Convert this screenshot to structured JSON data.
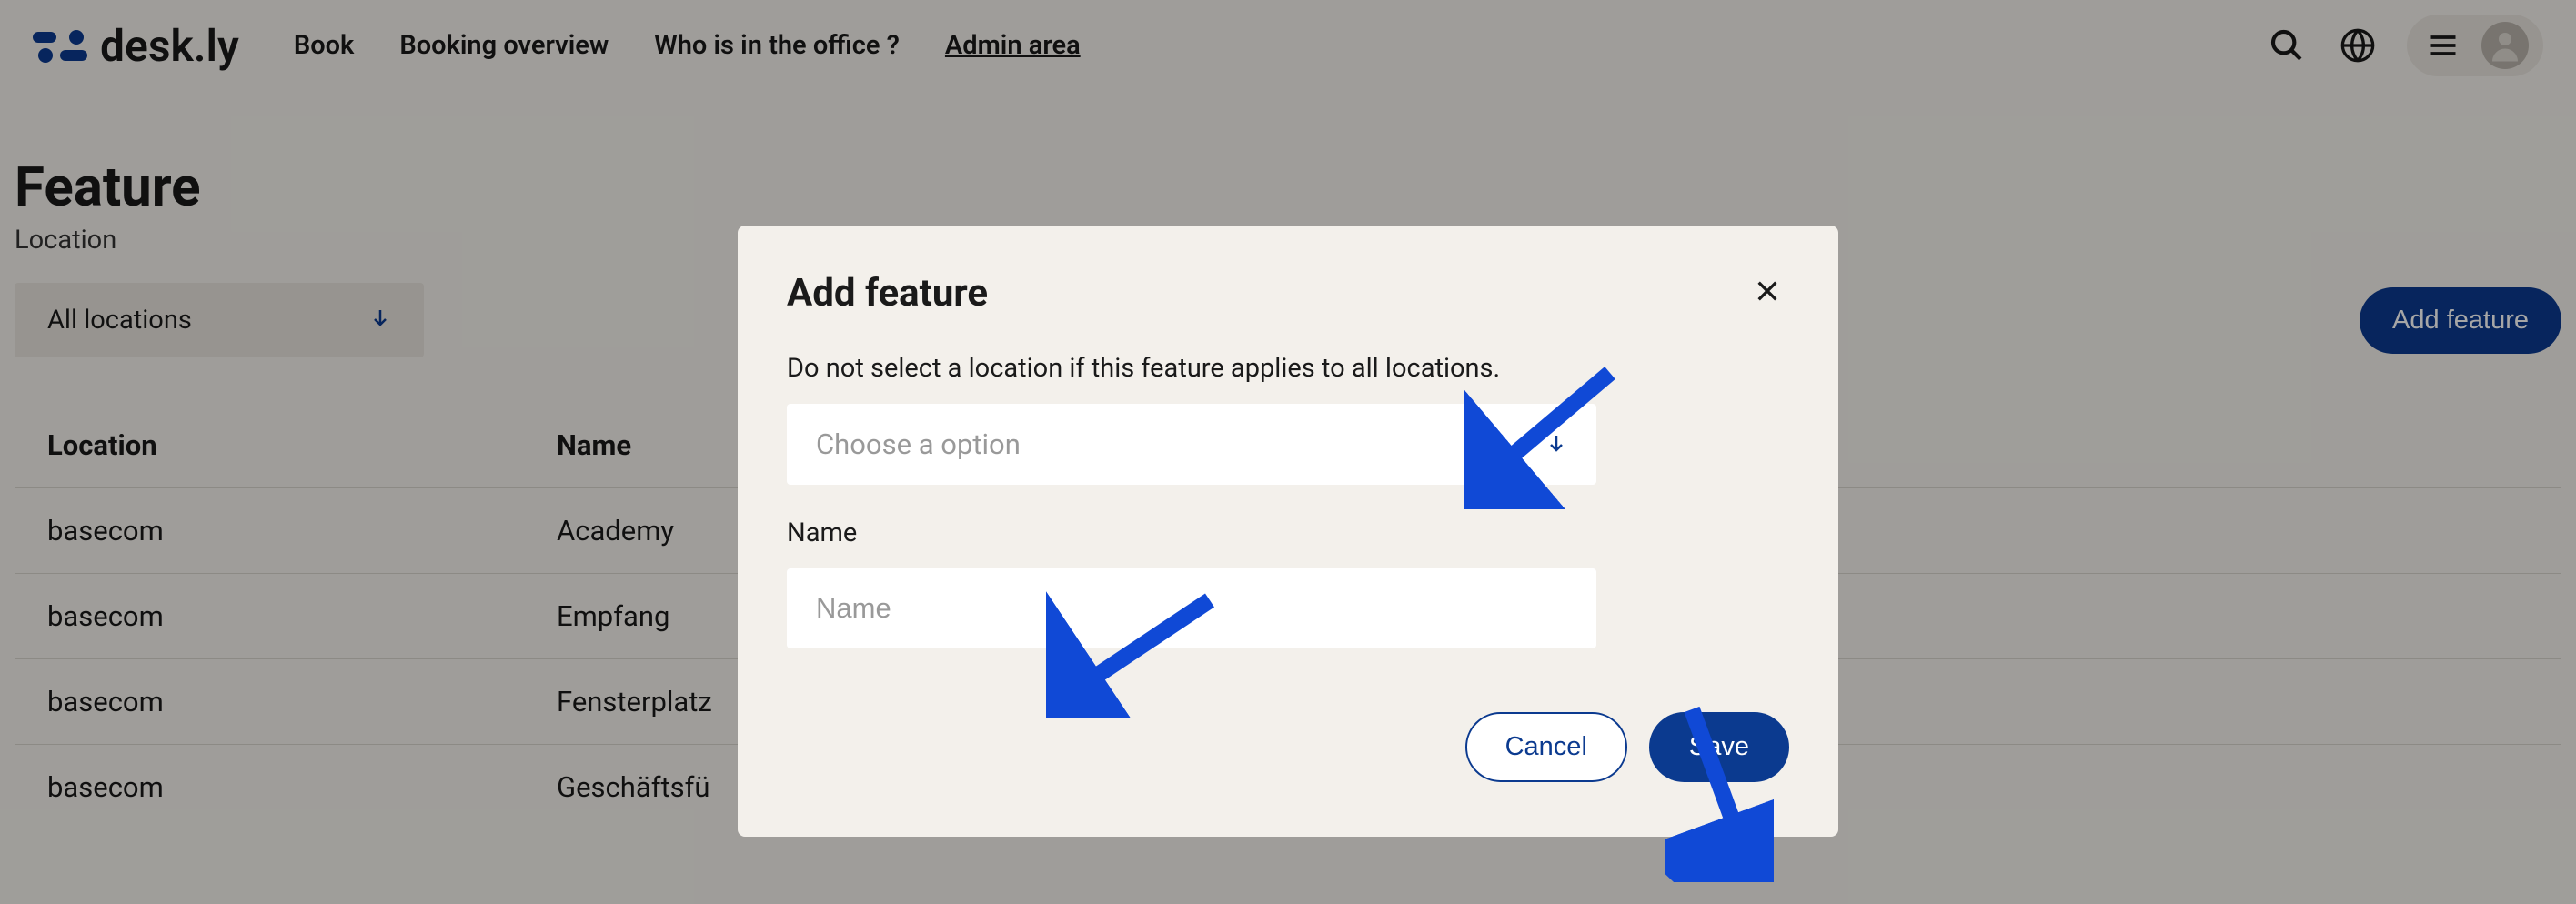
{
  "header": {
    "logo_text": "desk.ly",
    "nav": {
      "book": "Book",
      "booking_overview": "Booking overview",
      "who_office": "Who is in the office ?",
      "admin_area": "Admin area"
    }
  },
  "page": {
    "title": "Feature",
    "subtitle": "Location",
    "filter": {
      "label": "All locations"
    },
    "add_button": "Add feature"
  },
  "table": {
    "headers": {
      "location": "Location",
      "name": "Name"
    },
    "rows": [
      {
        "location": "basecom",
        "name": "Academy"
      },
      {
        "location": "basecom",
        "name": "Empfang"
      },
      {
        "location": "basecom",
        "name": "Fensterplatz"
      },
      {
        "location": "basecom",
        "name": "Geschäftsfü"
      }
    ]
  },
  "modal": {
    "title": "Add feature",
    "description": "Do not select a location if this feature applies to all locations.",
    "select_placeholder": "Choose a option",
    "name_label": "Name",
    "name_placeholder": "Name",
    "cancel": "Cancel",
    "save": "Save"
  }
}
